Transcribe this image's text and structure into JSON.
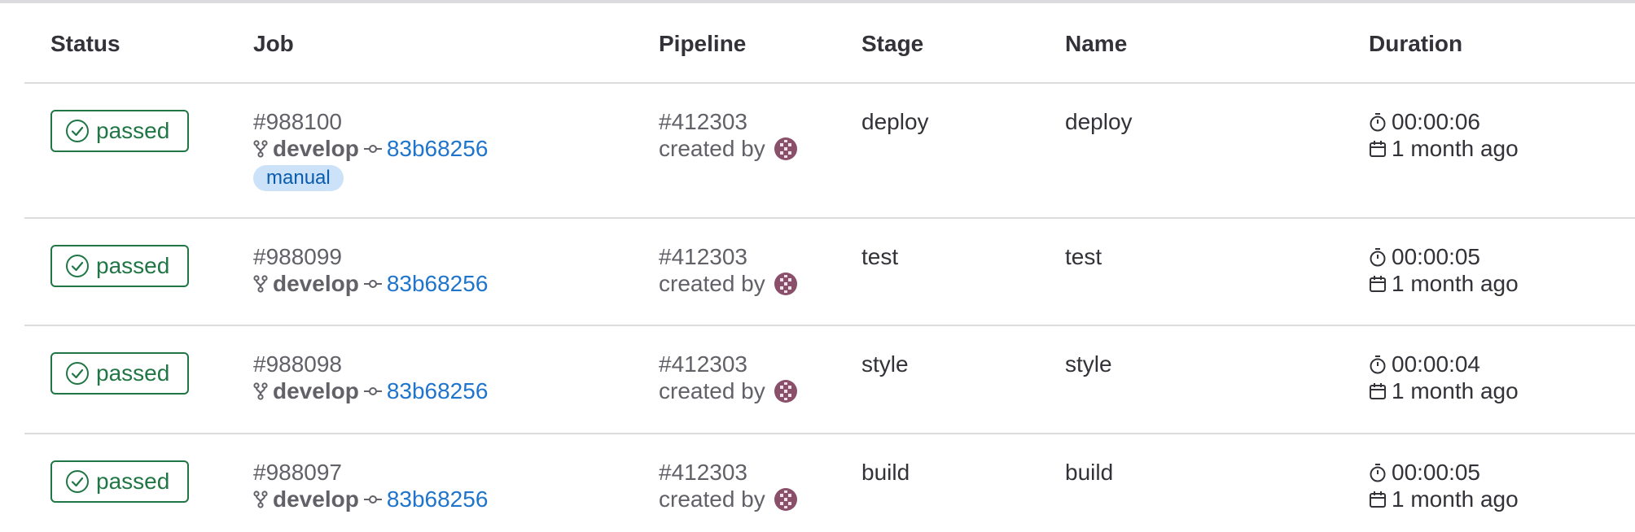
{
  "headers": {
    "status": "Status",
    "job": "Job",
    "pipeline": "Pipeline",
    "stage": "Stage",
    "name": "Name",
    "duration": "Duration"
  },
  "colors": {
    "success": "#217645",
    "link": "#1f75cb",
    "manual_bg": "#cbe2f9",
    "manual_text": "#0b5cad",
    "avatar": "#8a4f6a"
  },
  "icons": {
    "status": "check-circle-icon",
    "branch": "branch-icon",
    "commit": "commit-icon",
    "timer": "timer-icon",
    "calendar": "calendar-icon",
    "avatar": "user-avatar"
  },
  "jobs": [
    {
      "status": "passed",
      "job_id": "#988100",
      "branch": "develop",
      "sha": "83b68256",
      "tag": "manual",
      "pipeline_id": "#412303",
      "created_by": "created by",
      "stage": "deploy",
      "name": "deploy",
      "duration": "00:00:06",
      "finished": "1 month ago"
    },
    {
      "status": "passed",
      "job_id": "#988099",
      "branch": "develop",
      "sha": "83b68256",
      "pipeline_id": "#412303",
      "created_by": "created by",
      "stage": "test",
      "name": "test",
      "duration": "00:00:05",
      "finished": "1 month ago"
    },
    {
      "status": "passed",
      "job_id": "#988098",
      "branch": "develop",
      "sha": "83b68256",
      "pipeline_id": "#412303",
      "created_by": "created by",
      "stage": "style",
      "name": "style",
      "duration": "00:00:04",
      "finished": "1 month ago"
    },
    {
      "status": "passed",
      "job_id": "#988097",
      "branch": "develop",
      "sha": "83b68256",
      "pipeline_id": "#412303",
      "created_by": "created by",
      "stage": "build",
      "name": "build",
      "duration": "00:00:05",
      "finished": "1 month ago"
    }
  ]
}
